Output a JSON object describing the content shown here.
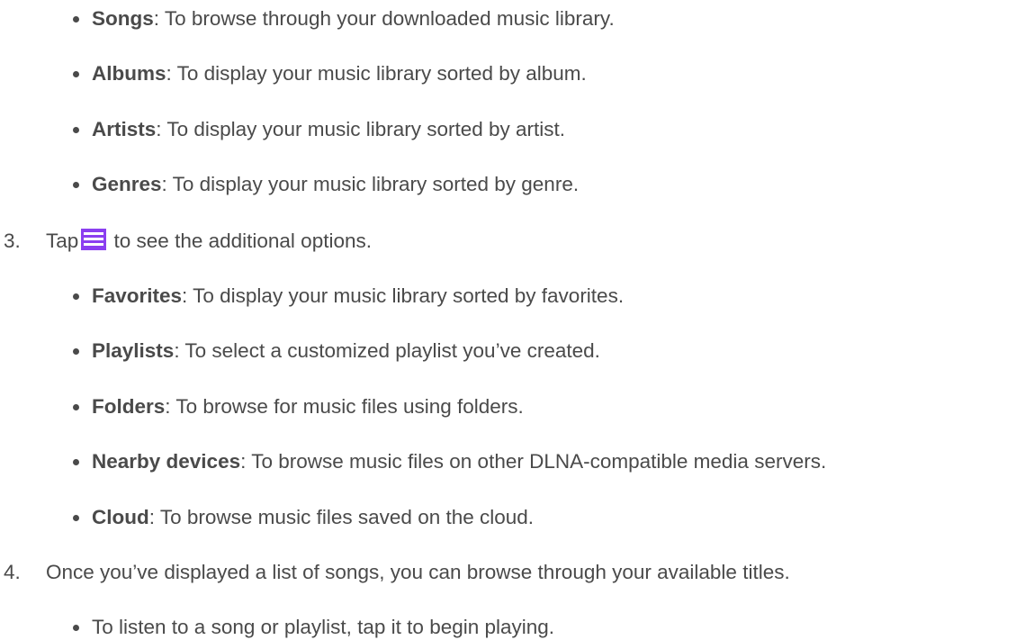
{
  "list_a": [
    {
      "term": "Songs",
      "desc": ": To browse through your downloaded music library."
    },
    {
      "term": "Albums",
      "desc": ": To display your music library sorted by album."
    },
    {
      "term": "Artists",
      "desc": ": To display your music library sorted by artist."
    },
    {
      "term": "Genres",
      "desc": ": To display your music library sorted by genre."
    }
  ],
  "step3": {
    "number": "3.",
    "before_icon": "Tap",
    "icon": "menu-icon",
    "after_icon": " to see the additional options."
  },
  "list_b": [
    {
      "term": "Favorites",
      "desc": ": To display your music library sorted by favorites."
    },
    {
      "term": "Playlists",
      "desc": ": To select a customized playlist you’ve created."
    },
    {
      "term": "Folders",
      "desc": ": To browse for music files using folders."
    },
    {
      "term": "Nearby devices",
      "desc": ": To browse music files on other DLNA-compatible media servers."
    },
    {
      "term": "Cloud",
      "desc": ": To browse music files saved on the cloud."
    }
  ],
  "step4": {
    "number": "4.",
    "text": "Once you’ve displayed a list of songs, you can browse through your available titles."
  },
  "list_c": [
    {
      "text": "To listen to a song or playlist, tap it to begin playing."
    }
  ],
  "colors": {
    "text": "#4a4a4a",
    "icon_accent": "#8b3ff0"
  }
}
